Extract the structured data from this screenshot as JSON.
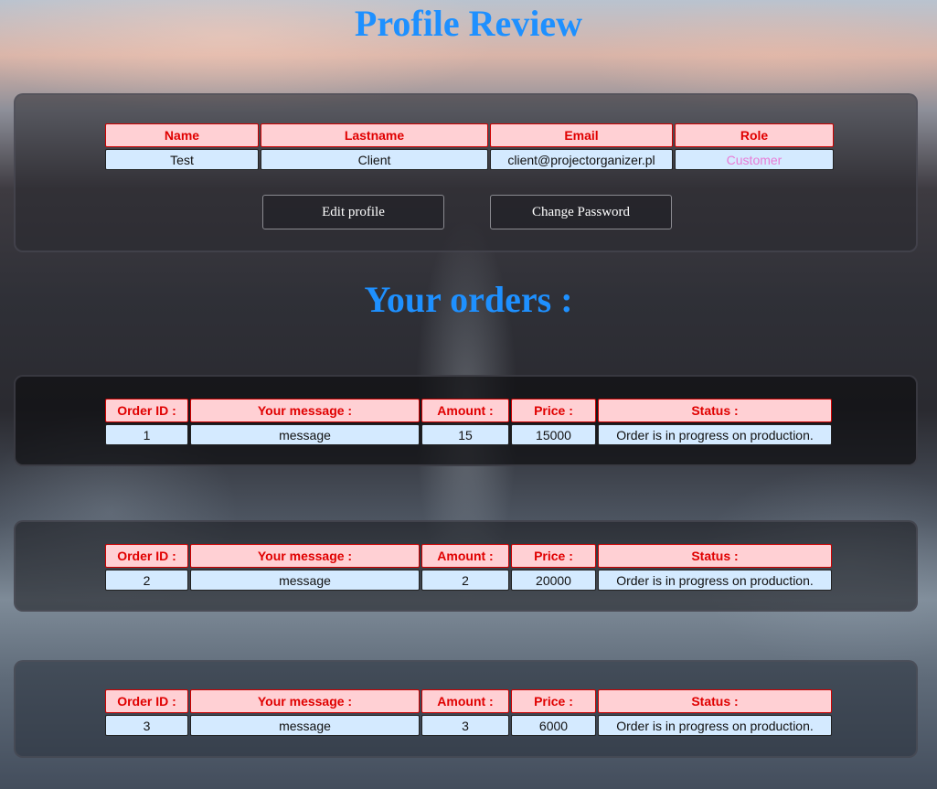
{
  "page_title": "Profile Review",
  "profile": {
    "headers": [
      "Name",
      "Lastname",
      "Email",
      "Role"
    ],
    "values": [
      "Test",
      "Client",
      "client@projectorganizer.pl",
      "Customer"
    ],
    "edit_button": "Edit profile",
    "password_button": "Change Password"
  },
  "orders_title": "Your orders :",
  "order_headers": [
    "Order ID :",
    "Your message :",
    "Amount :",
    "Price :",
    "Status :"
  ],
  "orders": [
    {
      "id": "1",
      "message": "message",
      "amount": "15",
      "price": "15000",
      "status": "Order is in progress on production."
    },
    {
      "id": "2",
      "message": "message",
      "amount": "2",
      "price": "20000",
      "status": "Order is in progress on production."
    },
    {
      "id": "3",
      "message": "message",
      "amount": "3",
      "price": "6000",
      "status": "Order is in progress on production."
    }
  ],
  "colors": {
    "title": "#1e90ff",
    "header_bg": "#ffd0d4",
    "header_text": "#e00000",
    "cell_bg": "#d4eaff",
    "role_text": "#e87bd6"
  }
}
